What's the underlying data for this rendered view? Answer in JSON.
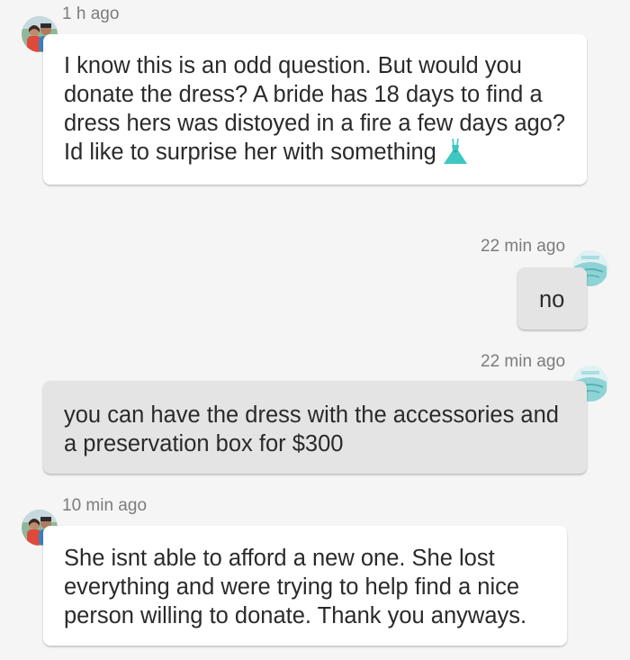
{
  "messages": [
    {
      "timestamp": "1 h ago",
      "direction": "incoming",
      "lines": [
        "I know this is an odd question. But would you",
        "donate the dress? A bride has 18 days to find a",
        "dress hers was distoyed in a fire a few days ago?",
        "Id like to surprise her with something"
      ],
      "emoji": "dress-icon"
    },
    {
      "timestamp": "22 min ago",
      "direction": "outgoing",
      "lines": [
        "no"
      ]
    },
    {
      "timestamp": "22 min ago",
      "direction": "outgoing",
      "lines": [
        "you can have the dress with the accessories and",
        "a preservation box for $300"
      ]
    },
    {
      "timestamp": "10 min ago",
      "direction": "incoming",
      "lines": [
        "She isnt able to afford a new one. She lost",
        "everything and were trying to help find a nice",
        "person willing to donate. Thank you anyways."
      ]
    }
  ],
  "colors": {
    "background": "#f5f5f5",
    "incoming_bubble": "#ffffff",
    "outgoing_bubble": "#e4e4e4",
    "timestamp": "#7c7c7c",
    "text": "#2a2a2a",
    "dress_emoji": "#3fc7c2"
  }
}
